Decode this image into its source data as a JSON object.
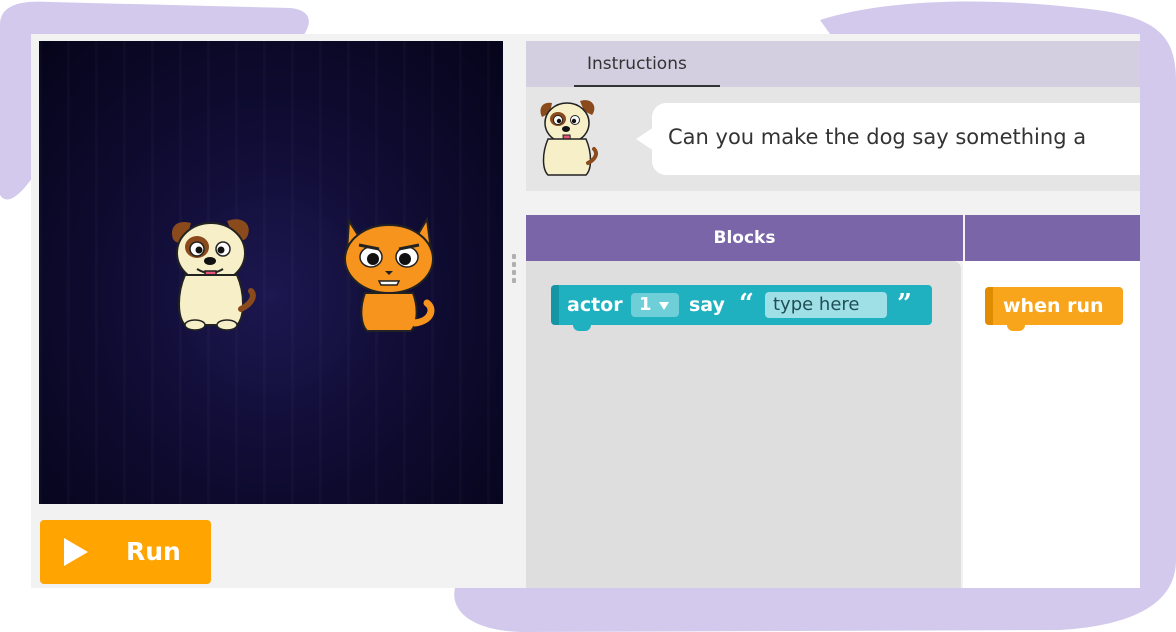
{
  "run_button": {
    "label": "Run"
  },
  "instructions": {
    "tab_label": "Instructions",
    "text": "Can you make the dog say something a"
  },
  "blocks_panel": {
    "header": "Blocks"
  },
  "toolbox_blocks": {
    "say_block": {
      "actor_label": "actor",
      "actor_value": "1",
      "say_label": "say",
      "open_quote": "“",
      "text_placeholder": "type here",
      "close_quote": "”"
    }
  },
  "workspace_blocks": {
    "when_run": {
      "label": "when run"
    }
  },
  "icons": {
    "run": "play-icon",
    "dog": "dog-sprite",
    "cat": "cat-sprite"
  },
  "colors": {
    "decor_blob": "#d2c9ec",
    "stage_bg": "#0f0b33",
    "run_orange": "#ffa400",
    "header_purple": "#7965a7",
    "instructions_header": "#d3cfe0",
    "say_block_teal": "#20b1c0",
    "event_block_orange": "#f8a51b"
  }
}
